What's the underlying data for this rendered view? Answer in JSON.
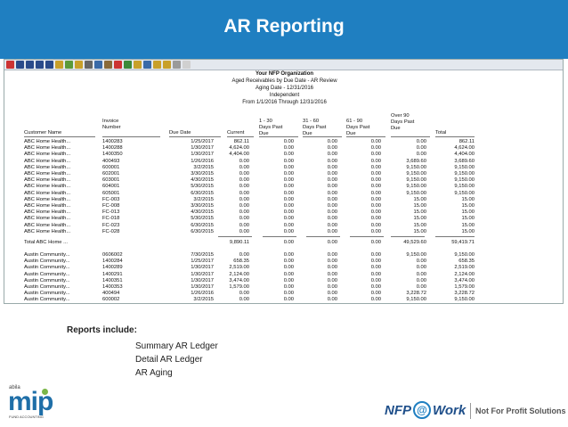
{
  "slide": {
    "title": "AR Reporting",
    "header_color": "#1f7fc1"
  },
  "report": {
    "org": "Your NFP Organization",
    "subtitle": "Aged Receivables by Due Date - AR Review",
    "aging_date": "Aging Date - 12/31/2016",
    "scope": "Independent",
    "range": "From 1/1/2016 Through 12/31/2016",
    "columns": {
      "customer": "Customer Name",
      "invoice": "Invoice\nNumber",
      "due_date": "Due Date",
      "current": "Current",
      "d1_30": "1 - 30\nDays Past\nDue",
      "d31_60": "31 - 60\nDays Past\nDue",
      "d61_90": "61 - 90\nDays Past\nDue",
      "over90": "Over 90\nDays Past\nDue",
      "total": "Total"
    },
    "rows": [
      {
        "c": "ABC Home Health...",
        "i": "1400283",
        "d": "1/25/2017",
        "cur": "862.11",
        "a": "0.00",
        "b": "0.00",
        "e": "0.00",
        "o": "0.00",
        "t": "862.11"
      },
      {
        "c": "ABC Home Health...",
        "i": "1400288",
        "d": "1/30/2017",
        "cur": "4,624.00",
        "a": "0.00",
        "b": "0.00",
        "e": "0.00",
        "o": "0.00",
        "t": "4,624.00"
      },
      {
        "c": "ABC Home Health...",
        "i": "1400350",
        "d": "1/30/2017",
        "cur": "4,404.00",
        "a": "0.00",
        "b": "0.00",
        "e": "0.00",
        "o": "0.00",
        "t": "4,404.00"
      },
      {
        "c": "ABC Home Health...",
        "i": "400493",
        "d": "1/26/2016",
        "cur": "0.00",
        "a": "0.00",
        "b": "0.00",
        "e": "0.00",
        "o": "3,689.60",
        "t": "3,689.60"
      },
      {
        "c": "ABC Home Health...",
        "i": "600001",
        "d": "3/2/2015",
        "cur": "0.00",
        "a": "0.00",
        "b": "0.00",
        "e": "0.00",
        "o": "9,150.00",
        "t": "9,150.00"
      },
      {
        "c": "ABC Home Health...",
        "i": "602001",
        "d": "3/30/2015",
        "cur": "0.00",
        "a": "0.00",
        "b": "0.00",
        "e": "0.00",
        "o": "9,150.00",
        "t": "9,150.00"
      },
      {
        "c": "ABC Home Health...",
        "i": "603001",
        "d": "4/30/2015",
        "cur": "0.00",
        "a": "0.00",
        "b": "0.00",
        "e": "0.00",
        "o": "9,150.00",
        "t": "9,150.00"
      },
      {
        "c": "ABC Home Health...",
        "i": "604001",
        "d": "5/30/2015",
        "cur": "0.00",
        "a": "0.00",
        "b": "0.00",
        "e": "0.00",
        "o": "9,150.00",
        "t": "9,150.00"
      },
      {
        "c": "ABC Home Health...",
        "i": "605001",
        "d": "6/30/2015",
        "cur": "0.00",
        "a": "0.00",
        "b": "0.00",
        "e": "0.00",
        "o": "9,150.00",
        "t": "9,150.00"
      },
      {
        "c": "ABC Home Health...",
        "i": "FC-003",
        "d": "3/2/2015",
        "cur": "0.00",
        "a": "0.00",
        "b": "0.00",
        "e": "0.00",
        "o": "15.00",
        "t": "15.00"
      },
      {
        "c": "ABC Home Health...",
        "i": "FC-008",
        "d": "3/30/2015",
        "cur": "0.00",
        "a": "0.00",
        "b": "0.00",
        "e": "0.00",
        "o": "15.00",
        "t": "15.00"
      },
      {
        "c": "ABC Home Health...",
        "i": "FC-013",
        "d": "4/30/2015",
        "cur": "0.00",
        "a": "0.00",
        "b": "0.00",
        "e": "0.00",
        "o": "15.00",
        "t": "15.00"
      },
      {
        "c": "ABC Home Health...",
        "i": "FC-018",
        "d": "5/30/2015",
        "cur": "0.00",
        "a": "0.00",
        "b": "0.00",
        "e": "0.00",
        "o": "15.00",
        "t": "15.00"
      },
      {
        "c": "ABC Home Health...",
        "i": "FC-023",
        "d": "6/30/2015",
        "cur": "0.00",
        "a": "0.00",
        "b": "0.00",
        "e": "0.00",
        "o": "15.00",
        "t": "15.00"
      },
      {
        "c": "ABC Home Health...",
        "i": "FC-028",
        "d": "6/30/2015",
        "cur": "0.00",
        "a": "0.00",
        "b": "0.00",
        "e": "0.00",
        "o": "15.00",
        "t": "15.00"
      }
    ],
    "subtotal": {
      "c": "Total ABC Home ...",
      "cur": "9,890.11",
      "a": "0.00",
      "b": "0.00",
      "e": "0.00",
      "o": "49,529.60",
      "t": "59,419.71"
    },
    "rows2": [
      {
        "c": "Austin Community...",
        "i": "0606002",
        "d": "7/30/2015",
        "cur": "0.00",
        "a": "0.00",
        "b": "0.00",
        "e": "0.00",
        "o": "9,150.00",
        "t": "9,150.00"
      },
      {
        "c": "Austin Community...",
        "i": "1400284",
        "d": "1/25/2017",
        "cur": "658.35",
        "a": "0.00",
        "b": "0.00",
        "e": "0.00",
        "o": "0.00",
        "t": "658.35"
      },
      {
        "c": "Austin Community...",
        "i": "1400289",
        "d": "1/30/2017",
        "cur": "2,519.00",
        "a": "0.00",
        "b": "0.00",
        "e": "0.00",
        "o": "0.00",
        "t": "2,519.00"
      },
      {
        "c": "Austin Community...",
        "i": "1400291",
        "d": "1/30/2017",
        "cur": "2,124.00",
        "a": "0.00",
        "b": "0.00",
        "e": "0.00",
        "o": "0.00",
        "t": "2,124.00"
      },
      {
        "c": "Austin Community...",
        "i": "1400351",
        "d": "1/30/2017",
        "cur": "3,474.00",
        "a": "0.00",
        "b": "0.00",
        "e": "0.00",
        "o": "0.00",
        "t": "3,474.00"
      },
      {
        "c": "Austin Community...",
        "i": "1400353",
        "d": "1/30/2017",
        "cur": "1,579.00",
        "a": "0.00",
        "b": "0.00",
        "e": "0.00",
        "o": "0.00",
        "t": "1,579.00"
      },
      {
        "c": "Austin Community...",
        "i": "400494",
        "d": "1/26/2016",
        "cur": "0.00",
        "a": "0.00",
        "b": "0.00",
        "e": "0.00",
        "o": "3,228.72",
        "t": "3,228.72"
      },
      {
        "c": "Austin Community...",
        "i": "600002",
        "d": "3/2/2015",
        "cur": "0.00",
        "a": "0.00",
        "b": "0.00",
        "e": "0.00",
        "o": "9,150.00",
        "t": "9,150.00"
      }
    ]
  },
  "notes": {
    "lead": "Reports include:",
    "items": [
      "Summary AR Ledger",
      "Detail AR Ledger",
      "AR Aging"
    ]
  },
  "logos": {
    "left_small": "abila",
    "left_big": "mip",
    "left_tag": "FUND ACCOUNTING",
    "right_nfp": "NFP",
    "right_at": "@",
    "right_work": "Work",
    "right_tagline": "Not For Profit Solutions"
  }
}
